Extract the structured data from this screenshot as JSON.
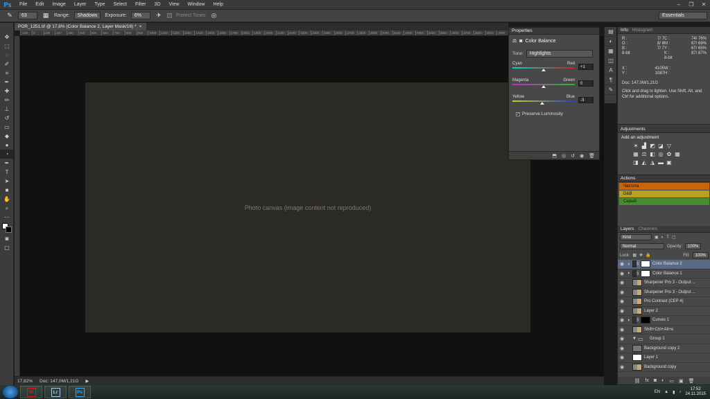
{
  "app": {
    "logo": "Ps",
    "menu": [
      "File",
      "Edit",
      "Image",
      "Layer",
      "Type",
      "Select",
      "Filter",
      "3D",
      "View",
      "Window",
      "Help"
    ],
    "window_controls": [
      "–",
      "❐",
      "✕"
    ]
  },
  "options": {
    "brush_size": "63",
    "range_label": "Range:",
    "range_value": "Shadows",
    "exposure_label": "Exposure:",
    "exposure_value": "6%",
    "protect_tones": "Protect Tones",
    "workspace": "Essentials"
  },
  "document": {
    "tab_title": "POR_1251.tif @ 17,8% (Color Balance 2, Layer Mask/16) *",
    "close": "×",
    "ruler_ticks": [
      "-100",
      "0",
      "100",
      "200",
      "300",
      "400",
      "500",
      "600",
      "700",
      "800",
      "900",
      "1000",
      "1100",
      "1200",
      "1300",
      "1400",
      "1500",
      "1600",
      "1700",
      "1800",
      "1900",
      "2000",
      "2100",
      "2200",
      "2300",
      "2400",
      "2500",
      "2600",
      "2700",
      "2800",
      "2900",
      "3000",
      "3100",
      "3200",
      "3300",
      "3400",
      "3500",
      "3600",
      "3700",
      "3800",
      "3900",
      "4000"
    ],
    "image_alt": "Photo canvas (image content not reproduced)"
  },
  "status": {
    "zoom": "17,82%",
    "doc_size": "Doc: 147,0M/1,21G"
  },
  "properties": {
    "tab": "Properties",
    "title": "Color Balance",
    "tone_label": "Tone:",
    "tone_value": "Highlights",
    "sliders": [
      {
        "left": "Cyan",
        "right": "Red",
        "value": "+1",
        "position": 0.5
      },
      {
        "left": "Magenta",
        "right": "Green",
        "value": "0",
        "position": 0.5
      },
      {
        "left": "Yellow",
        "right": "Blue",
        "value": "-3",
        "position": 0.48
      }
    ],
    "preserve": "Preserve Luminosity"
  },
  "info": {
    "tabs": [
      "Info",
      "Histogram"
    ],
    "rgb_left": [
      [
        "R :",
        "7/  7"
      ],
      [
        "G :",
        "8/  8"
      ],
      [
        "B :",
        "7/  7"
      ]
    ],
    "bit_left": "8-bit",
    "cmyk_right": [
      [
        "C :",
        "74/ 76%"
      ],
      [
        "M :",
        "67/ 69%"
      ],
      [
        "Y :",
        "67/ 65%"
      ],
      [
        "K :",
        "87/ 87%"
      ]
    ],
    "bit_right": "8-bit",
    "xy": [
      [
        "X :",
        "4105"
      ],
      [
        "Y :",
        "1087"
      ]
    ],
    "wh": [
      [
        "W :",
        ""
      ],
      [
        "H :",
        ""
      ]
    ],
    "doc": "Doc: 147,0M/1,21G",
    "hint": "Click and drag to lighten. Use Shift, Alt, and Ctrl for additional options."
  },
  "adjustments": {
    "tab": "Adjustments",
    "title": "Add an adjustment"
  },
  "actions": {
    "tab": "Actions",
    "items": [
      {
        "name": "Частота",
        "color": "#c8640a"
      },
      {
        "name": "D&B",
        "color": "#b8a020"
      },
      {
        "name": "Серый",
        "color": "#4a8a30"
      }
    ]
  },
  "layers": {
    "tabs": [
      "Layers",
      "Channels"
    ],
    "kind": "Kind",
    "blend": "Normal",
    "opacity_label": "Opacity:",
    "opacity": "100%",
    "lock_label": "Lock:",
    "fill_label": "Fill:",
    "fill": "100%",
    "rows": [
      {
        "name": "Color Balance 2",
        "thumb": "white",
        "adj": true,
        "selected": true
      },
      {
        "name": "Color Balance 1",
        "thumb": "white",
        "adj": true,
        "selected": false
      },
      {
        "name": "Sharpener Pro 3 - Output ...",
        "thumb": "doc",
        "adj": false,
        "selected": false
      },
      {
        "name": "Sharpener Pro 3 - Output ...",
        "thumb": "doc",
        "adj": false,
        "selected": false
      },
      {
        "name": "Pro Contrast (CEP 4)",
        "thumb": "doc",
        "adj": false,
        "selected": false
      },
      {
        "name": "Layer 2",
        "thumb": "doc",
        "adj": false,
        "selected": false
      },
      {
        "name": "Curves 1",
        "thumb": "black",
        "adj": true,
        "selected": false
      },
      {
        "name": "Shift+Ctrl+Alt+e",
        "thumb": "doc",
        "adj": false,
        "selected": false
      },
      {
        "name": "Group 1",
        "thumb": "folder",
        "adj": false,
        "selected": false
      },
      {
        "name": "Background copy 2",
        "thumb": "gray",
        "adj": false,
        "selected": false
      },
      {
        "name": "Layer 1",
        "thumb": "white",
        "adj": false,
        "selected": false
      },
      {
        "name": "Background copy",
        "thumb": "doc",
        "adj": false,
        "selected": false
      }
    ]
  },
  "taskbar": {
    "apps": [
      {
        "name": "Opera",
        "label": "O",
        "color": "#d01c1c"
      },
      {
        "name": "Lightroom",
        "label": "Lr",
        "color": "#a8c8e8"
      },
      {
        "name": "Photoshop",
        "label": "Ps",
        "color": "#31a8ff"
      }
    ],
    "lang": "EN",
    "time": "17:52",
    "date": "24.11.2015"
  }
}
